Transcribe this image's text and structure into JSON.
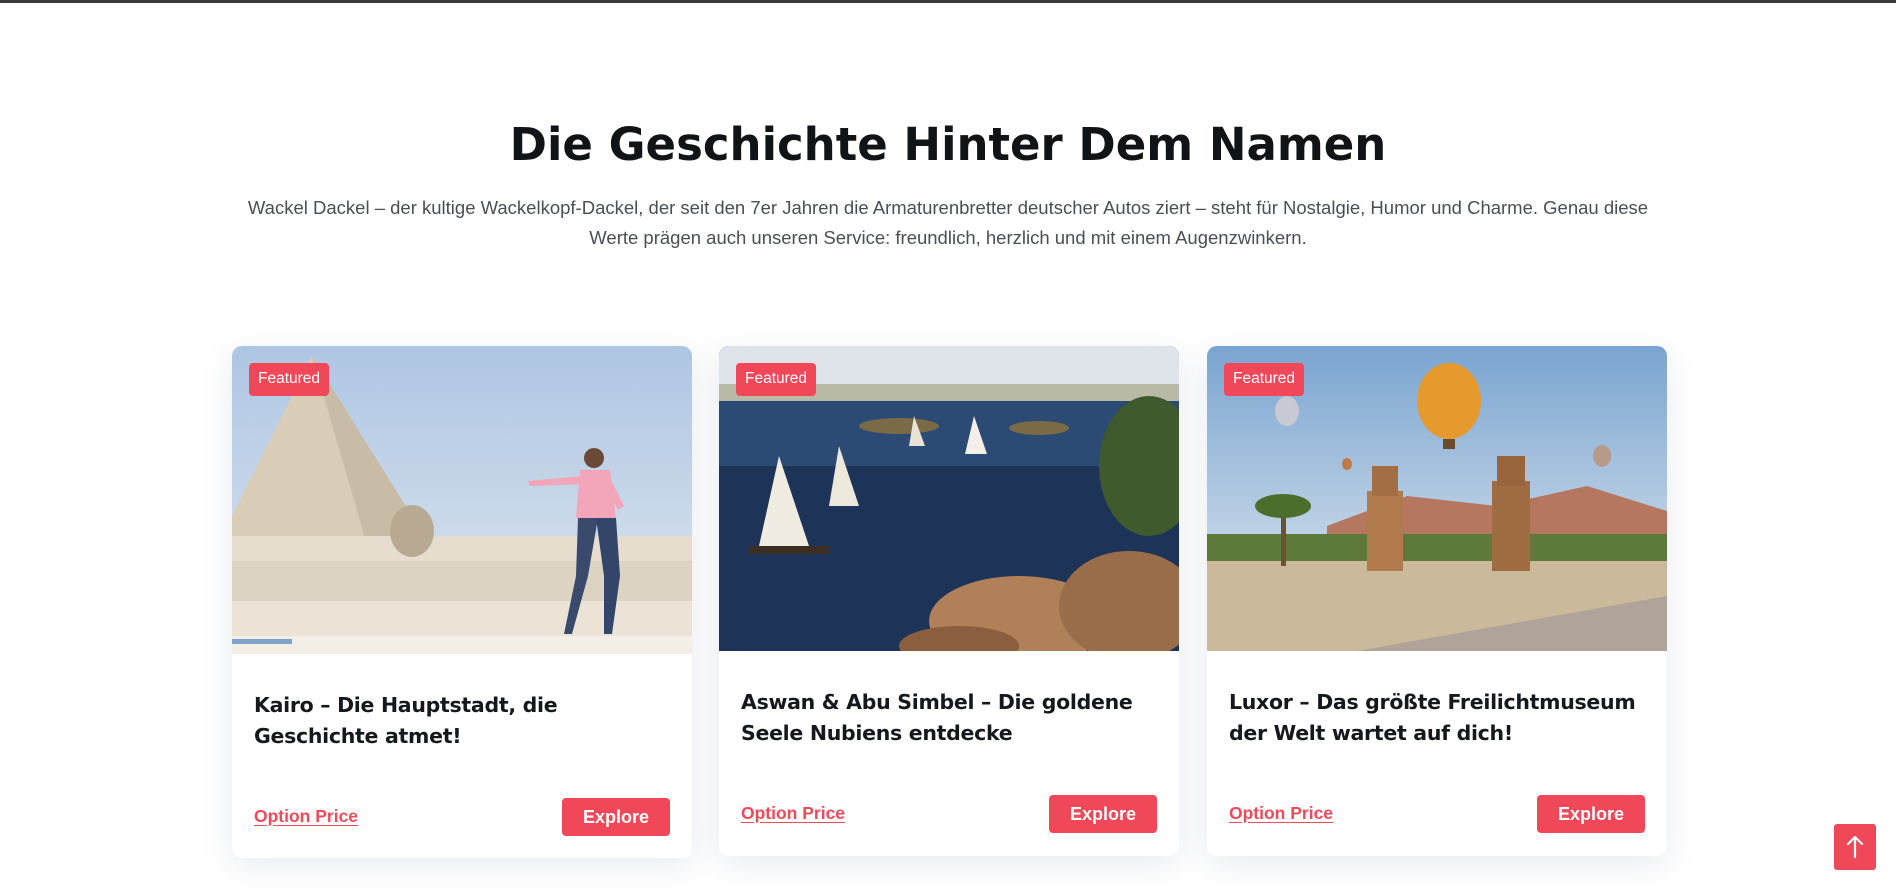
{
  "intro": {
    "title": "Die Geschichte Hinter Dem Namen",
    "text": "Wackel Dackel – der kultige Wackelkopf-Dackel, der seit den 7er Jahren die Armaturenbretter deutscher Autos ziert – steht für Nostalgie, Humor und Charme. Genau diese Werte prägen auch unseren Service: freundlich, herzlich und mit einem Augenzwinkern."
  },
  "cards": [
    {
      "badge": "Featured",
      "title": "Kairo – Die Hauptstadt, die Geschichte atmet!",
      "price_link": "Option Price",
      "button": "Explore"
    },
    {
      "badge": "Featured",
      "title": "Aswan & Abu Simbel – Die goldene Seele Nubiens entdecke",
      "price_link": "Option Price",
      "button": "Explore"
    },
    {
      "badge": "Featured",
      "title": "Luxor – Das größte Freilichtmuseum der Welt wartet auf dich!",
      "price_link": "Option Price",
      "button": "Explore"
    }
  ],
  "scroll_top": {
    "icon": "arrow-up-icon"
  },
  "colors": {
    "accent": "#f04858",
    "heading": "#111417",
    "body_text": "#4a4f55"
  }
}
